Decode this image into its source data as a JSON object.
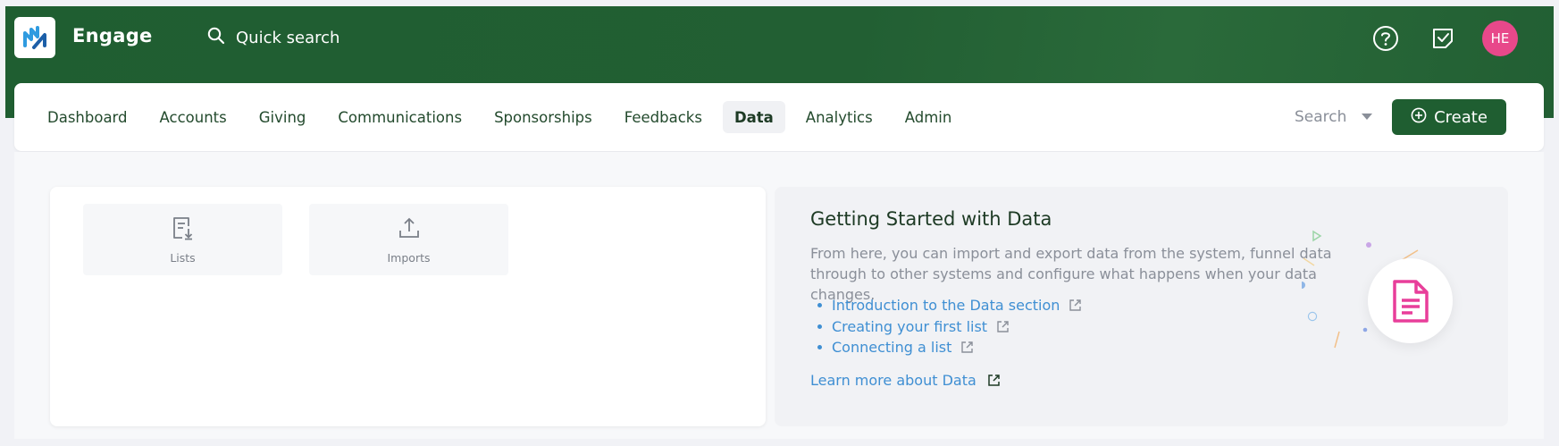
{
  "app": {
    "name": "Engage",
    "logo_icon": "engage-logo-icon"
  },
  "quick_search": {
    "label": "Quick search",
    "icon": "search-icon"
  },
  "top_icons": {
    "help": "help-circle-icon",
    "tasks": "task-check-icon",
    "avatar_initials": "HE",
    "avatar_color": "#e8488a"
  },
  "nav": {
    "tabs": [
      {
        "label": "Dashboard"
      },
      {
        "label": "Accounts"
      },
      {
        "label": "Giving"
      },
      {
        "label": "Communications"
      },
      {
        "label": "Sponsorships"
      },
      {
        "label": "Feedbacks"
      },
      {
        "label": "Data",
        "active": true
      },
      {
        "label": "Analytics"
      },
      {
        "label": "Admin"
      }
    ],
    "search_label": "Search",
    "create_label": "Create"
  },
  "tiles": [
    {
      "label": "Lists",
      "icon": "list-download-icon"
    },
    {
      "label": "Imports",
      "icon": "upload-icon"
    }
  ],
  "getting_started": {
    "title": "Getting Started with Data",
    "description": "From here, you can import and export data from the system, funnel data through to other systems and configure what happens when your data changes.",
    "links": [
      {
        "label": "Introduction to the Data section"
      },
      {
        "label": "Creating your first list"
      },
      {
        "label": "Connecting a list"
      }
    ],
    "learn_more": "Learn more about Data"
  },
  "colors": {
    "brand_green": "#1f5e31",
    "link_blue": "#3f8fd3",
    "accent_pink": "#e8488a"
  }
}
